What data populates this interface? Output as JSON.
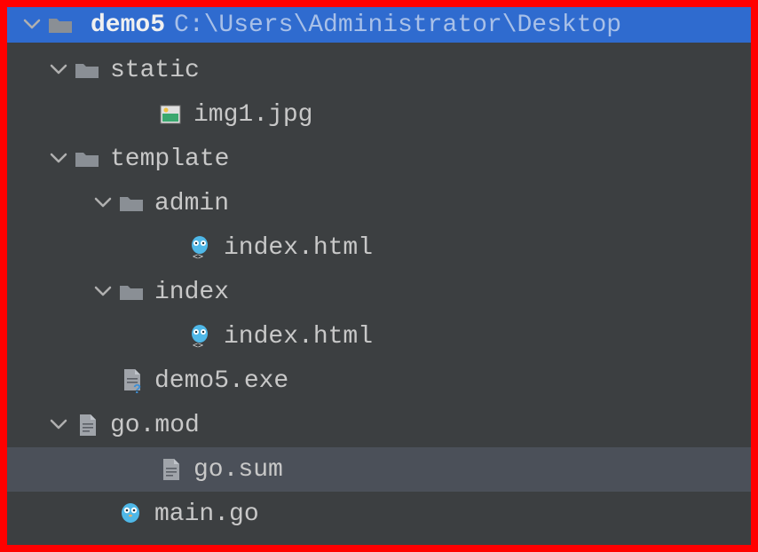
{
  "header": {
    "project_name": "demo5",
    "project_path": "C:\\Users\\Administrator\\Desktop"
  },
  "tree": {
    "static": {
      "label": "static"
    },
    "img1": {
      "label": "img1.jpg"
    },
    "template": {
      "label": "template"
    },
    "admin": {
      "label": "admin"
    },
    "admin_index_html": {
      "label": "index.html"
    },
    "index_folder": {
      "label": "index"
    },
    "index_index_html": {
      "label": "index.html"
    },
    "demo5_exe": {
      "label": "demo5.exe"
    },
    "go_mod": {
      "label": "go.mod"
    },
    "go_sum": {
      "label": "go.sum"
    },
    "main_go": {
      "label": "main.go"
    }
  },
  "icons": {
    "chevron_down": "chevron-down",
    "folder": "folder",
    "image_file": "image-file",
    "gopher_file": "gopher-file",
    "doc_file": "doc-file",
    "doc_unknown": "doc-unknown",
    "gopher": "gopher"
  }
}
